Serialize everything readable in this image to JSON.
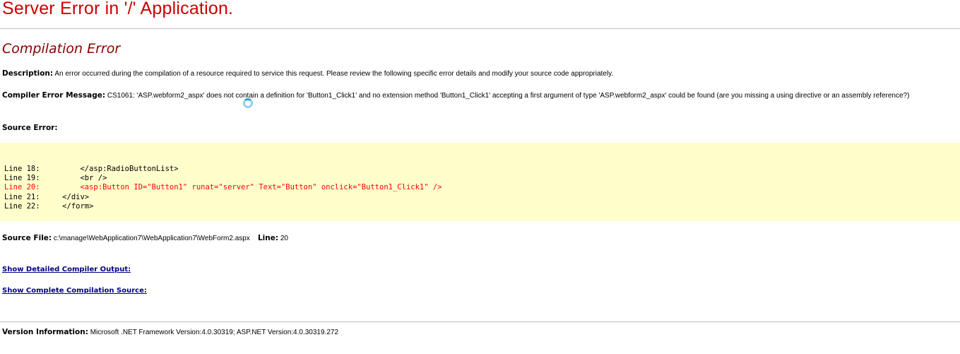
{
  "title": "Server Error in '/' Application.",
  "subtitle": "Compilation Error",
  "description": {
    "label": "Description:",
    "text": " An error occurred during the compilation of a resource required to service this request. Please review the following specific error details and modify your source code appropriately."
  },
  "compiler_error": {
    "label": "Compiler Error Message:",
    "text": " CS1061: 'ASP.webform2_aspx' does not contain a definition for 'Button1_Click1' and no extension method 'Button1_Click1' accepting a first argument of type 'ASP.webform2_aspx' could be found (are you missing a using directive or an assembly reference?)"
  },
  "source_error_label": "Source Error:",
  "source_lines": [
    {
      "text": "Line 18:         </asp:RadioButtonList>",
      "error": false
    },
    {
      "text": "Line 19:         <br />",
      "error": false
    },
    {
      "text": "Line 20:         <asp:Button ID=\"Button1\" runat=\"server\" Text=\"Button\" onclick=\"Button1_Click1\" />",
      "error": true
    },
    {
      "text": "Line 21:     </div>",
      "error": false
    },
    {
      "text": "Line 22:     </form>",
      "error": false
    }
  ],
  "source_file": {
    "label": "Source File:",
    "path": " c:\\manage\\WebApplication7\\WebApplication7\\WebForm2.aspx",
    "line_label": "Line:",
    "line_value": " 20"
  },
  "links": {
    "detailed_output": "Show Detailed Compiler Output:",
    "complete_source": "Show Complete Compilation Source:"
  },
  "version": {
    "label": "Version Information:",
    "text": " Microsoft .NET Framework Version:4.0.30319; ASP.NET Version:4.0.30319.272"
  },
  "colors": {
    "title": "#cc0000",
    "subtitle": "#8b0000",
    "code_background": "#ffffcc",
    "error_line": "#ff0000",
    "link": "#000080"
  },
  "icons": {
    "loading": "loading-spinner-icon"
  }
}
